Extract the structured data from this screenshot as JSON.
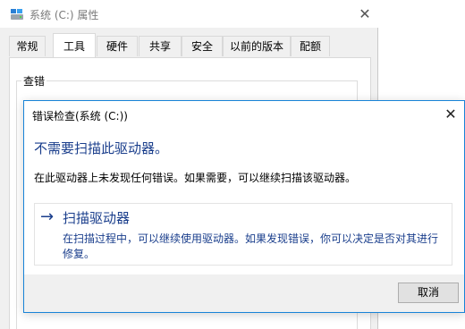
{
  "properties_window": {
    "title": "系统 (C:) 属性",
    "close_glyph": "✕",
    "tabs": [
      {
        "label": "常规",
        "active": false
      },
      {
        "label": "工具",
        "active": true
      },
      {
        "label": "硬件",
        "active": false
      },
      {
        "label": "共享",
        "active": false
      },
      {
        "label": "安全",
        "active": false
      },
      {
        "label": "以前的版本",
        "active": false
      },
      {
        "label": "配额",
        "active": false
      }
    ],
    "group_label": "查错"
  },
  "error_check_dialog": {
    "title": "错误检查(系统 (C:))",
    "close_glyph": "✕",
    "main_instruction": "不需要扫描此驱动器。",
    "content": "在此驱动器上未发现任何错误。如果需要，可以继续扫描该驱动器。",
    "command_link": {
      "arrow": "→",
      "title": "扫描驱动器",
      "description": "在扫描过程中，可以继续使用驱动器。如果发现错误，你可以决定是否对其进行修复。"
    },
    "cancel_label": "取消"
  },
  "colors": {
    "accent_blue": "#1a3e8c",
    "dialog_border": "#1883d7",
    "dialog_face": "#f0f0f0"
  },
  "icons": {
    "drive_icon": "drive-icon"
  }
}
